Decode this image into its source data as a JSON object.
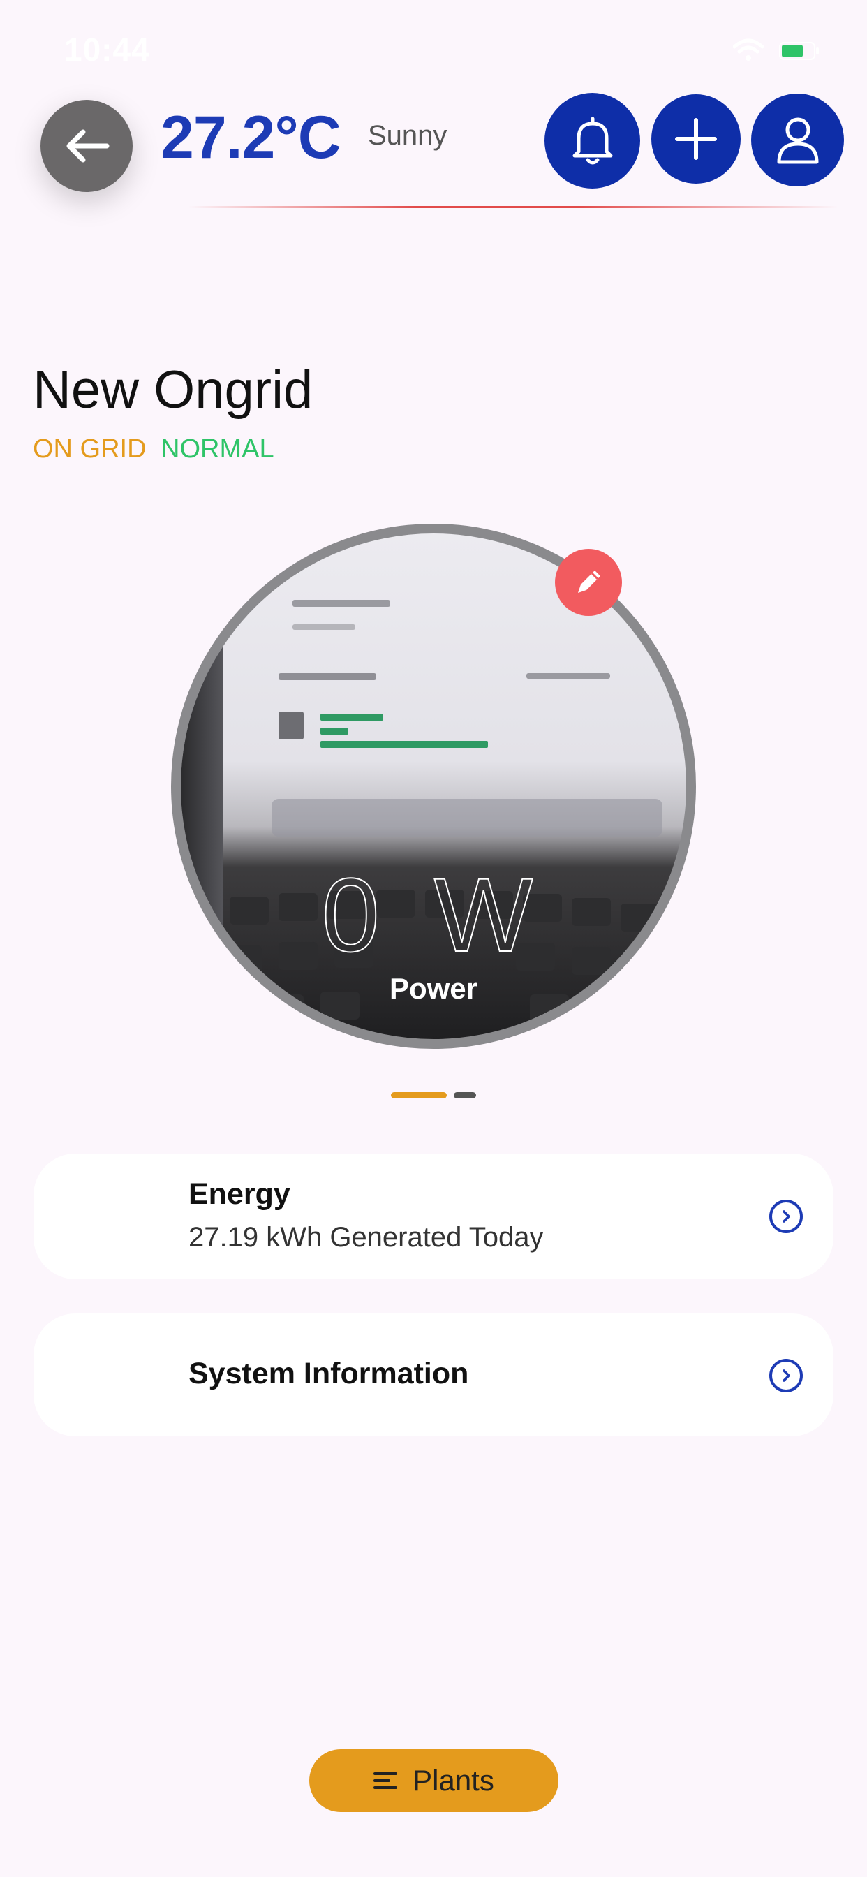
{
  "status_bar": {
    "time": "10:44"
  },
  "header": {
    "temperature": "27.2°C",
    "weather": "Sunny",
    "icons": {
      "back": "arrow-left-icon",
      "notifications": "bell-icon",
      "add": "plus-icon",
      "profile": "user-icon"
    }
  },
  "plant": {
    "name": "New Ongrid",
    "grid_type": "ON GRID",
    "status": "NORMAL"
  },
  "power": {
    "value": "0 W",
    "label": "Power"
  },
  "pager": {
    "pages": 2,
    "active": 0
  },
  "cards": [
    {
      "title": "Energy",
      "subtitle": "27.19 kWh Generated Today"
    },
    {
      "title": "System Information"
    }
  ],
  "bottom": {
    "plants_label": "Plants"
  },
  "colors": {
    "accent": "#0e2ea8",
    "temperature": "#1d3bb5",
    "grid_tag": "#e49b1d",
    "status_tag": "#2fc468",
    "edit": "#f25b5f",
    "background": "#fcf6fc"
  }
}
